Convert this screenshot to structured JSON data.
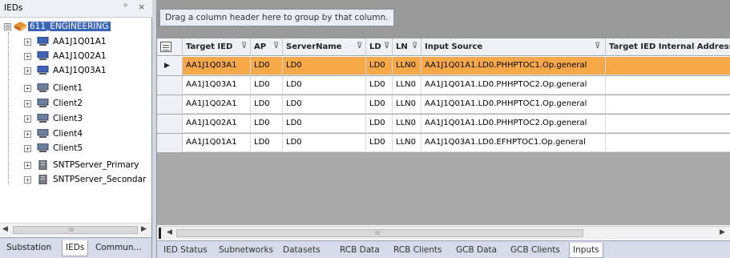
{
  "left_panel": {
    "title": "IEDs",
    "pin_glyph": "ᵖ",
    "close_glyph": "×",
    "root": {
      "expander": "⊟",
      "label": "611_ENGINEERING",
      "icon": "project-icon"
    },
    "nodes": [
      {
        "label": "AA1J1Q01A1",
        "icon": "ied-computer-icon"
      },
      {
        "label": "AA1J1Q02A1",
        "icon": "ied-computer-icon"
      },
      {
        "label": "AA1J1Q03A1",
        "icon": "ied-computer-icon"
      },
      {
        "label": "Client1",
        "icon": "client-computer-icon"
      },
      {
        "label": "Client2",
        "icon": "client-computer-icon"
      },
      {
        "label": "Client3",
        "icon": "client-computer-icon"
      },
      {
        "label": "Client4",
        "icon": "client-computer-icon"
      },
      {
        "label": "Client5",
        "icon": "client-computer-icon"
      },
      {
        "label": "SNTPServer_Primary",
        "icon": "server-icon"
      },
      {
        "label": "SNTPServer_Secondar",
        "icon": "server-icon"
      }
    ],
    "expander": "+",
    "scroll_left": "◀",
    "scroll_right": "▶",
    "scroll_grip": "III",
    "tabs": [
      "Substation",
      "IEDs",
      "Commun..."
    ],
    "active_tab": "IEDs"
  },
  "grid": {
    "group_hint": "Drag a column header here to group by that column.",
    "filter_glyph": "⊽",
    "columns": [
      "Target IED",
      "AP",
      "ServerName",
      "LD",
      "LN",
      "Input Source",
      "Target IED Internal Address"
    ],
    "rows": [
      [
        "AA1J1Q03A1",
        "LD0",
        "LD0",
        "LD0",
        "LLN0",
        "AA1J1Q01A1.LD0.PHHPTOC1.Op.general",
        ""
      ],
      [
        "AA1J1Q03A1",
        "LD0",
        "LD0",
        "LD0",
        "LLN0",
        "AA1J1Q01A1.LD0.PHHPTOC2.Op.general",
        ""
      ],
      [
        "AA1J1Q02A1",
        "LD0",
        "LD0",
        "LD0",
        "LLN0",
        "AA1J1Q01A1.LD0.PHHPTOC1.Op.general",
        ""
      ],
      [
        "AA1J1Q02A1",
        "LD0",
        "LD0",
        "LD0",
        "LLN0",
        "AA1J1Q01A1.LD0.PHHPTOC2.Op.general",
        ""
      ],
      [
        "AA1J1Q01A1",
        "LD0",
        "LD0",
        "LD0",
        "LLN0",
        "AA1J1Q03A1.LD0.EFHPTOC1.Op.general",
        ""
      ]
    ],
    "active_row_marker": "▶",
    "scroll_left": "◀",
    "scroll_right": "▶",
    "scroll_grip": "III"
  },
  "bottom_tabs": {
    "tabs": [
      "IED Status",
      "Subnetworks",
      "Datasets",
      "RCB Data",
      "RCB Clients",
      "GCB Data",
      "GCB Clients",
      "Inputs"
    ],
    "active_tab": "Inputs"
  },
  "colors": {
    "active_row": "#f7a94a",
    "selection": "#3a64b5",
    "group_area": "#9a9a9a"
  }
}
